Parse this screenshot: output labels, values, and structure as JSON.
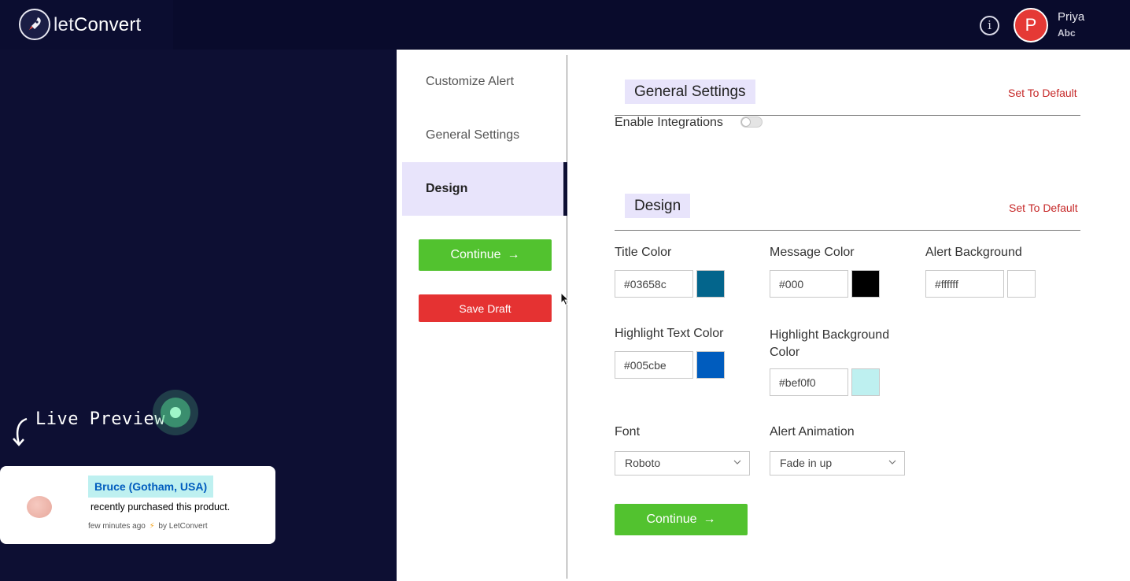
{
  "topbar": {
    "brand_prefix": "let",
    "brand_suffix": "Convert",
    "info_icon": "info-icon",
    "avatar_initial": "P",
    "user_name": "Priya",
    "user_org": "Abc"
  },
  "preview": {
    "label": "Live Preview",
    "name": "Bruce (Gotham, USA)",
    "message": "recently purchased this product.",
    "time": "few minutes ago",
    "by": "by LetConvert"
  },
  "steps": [
    {
      "label": "Customize Alert"
    },
    {
      "label": "General Settings"
    },
    {
      "label": "Design"
    }
  ],
  "actions": {
    "continue_label": "Continue",
    "save_draft_label": "Save Draft"
  },
  "general_settings": {
    "heading": "General Settings",
    "set_default": "Set To Default",
    "enable_integrations_label": "Enable Integrations",
    "enable_integrations": false
  },
  "design": {
    "heading": "Design",
    "set_default": "Set To Default",
    "title_color": {
      "label": "Title Color",
      "value": "#03658c"
    },
    "message_color": {
      "label": "Message Color",
      "value": "#000"
    },
    "alert_background": {
      "label": "Alert Background",
      "value": "#ffffff"
    },
    "highlight_text_color": {
      "label": "Highlight Text Color",
      "value": "#005cbe"
    },
    "highlight_background_color": {
      "label": "Highlight Background Color",
      "value": "#bef0f0"
    },
    "font": {
      "label": "Font",
      "value": "Roboto"
    },
    "alert_animation": {
      "label": "Alert Animation",
      "value": "Fade in up"
    }
  },
  "colors": {
    "accent_green": "#52c22f",
    "danger_red": "#e53232",
    "nav_active_bg": "#e8e4fb",
    "topbar_bg": "#090b2c"
  }
}
